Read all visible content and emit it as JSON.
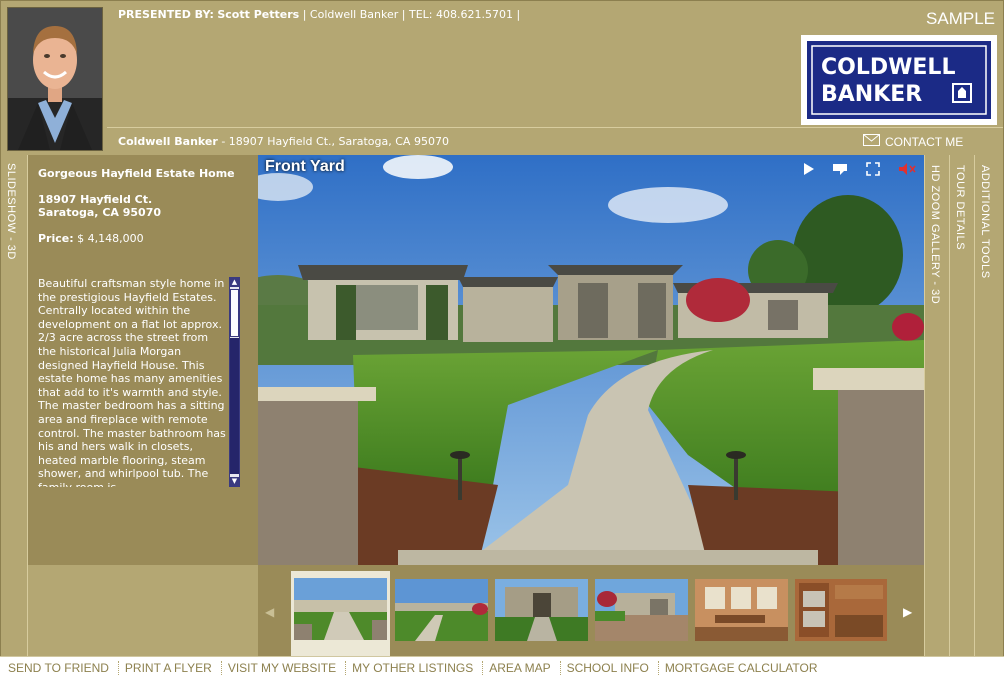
{
  "header": {
    "presented_label": "PRESENTED BY:",
    "agent_name": "Scott Petters",
    "company": "Coldwell Banker",
    "phone": "TEL: 408.621.5701",
    "separator": "|",
    "sample": "SAMPLE",
    "logo_line1": "COLDWELL",
    "logo_line2": "BANKER",
    "address_company": "Coldwell Banker",
    "address_text": "- 18907 Hayfield Ct., Saratoga, CA 95070",
    "contact_label": "CONTACT ME"
  },
  "tabs": {
    "left": "SLIDESHOW - 3D",
    "right": [
      "HD ZOOM GALLERY - 3D",
      "TOUR DETAILS",
      "ADDITIONAL TOOLS"
    ]
  },
  "property": {
    "title": "Gorgeous Hayfield Estate Home",
    "address_line1": "18907 Hayfield Ct.",
    "address_line2": "Saratoga, CA 95070",
    "price_label": "Price:",
    "price": "$ 4,148,000",
    "description": "Beautiful craftsman style home in the prestigious Hayfield Estates. Centrally located within the development on a flat lot approx. 2/3 acre across the street from the historical Julia Morgan designed Hayfield House. This estate home has many amenities that add to it's warmth and style. The master bedroom has a sitting area and fireplace with remote control. The master bathroom has his and hers walk in closets, heated marble flooring, steam shower, and whirlpool tub. The family room is"
  },
  "photo": {
    "title": "Front Yard",
    "controls": [
      "play-icon",
      "caption-icon",
      "fullscreen-icon",
      "mute-icon"
    ]
  },
  "footer": {
    "links": [
      "SEND TO FRIEND",
      "PRINT A FLYER",
      "VISIT MY WEBSITE",
      "MY OTHER LISTINGS",
      "AREA MAP",
      "SCHOOL INFO",
      "MORTGAGE CALCULATOR"
    ]
  },
  "colors": {
    "panel_gold": "#b4a773",
    "panel_dark": "#9a8b58",
    "brand_blue": "#1b2a86",
    "footer_text": "#8d814e"
  }
}
